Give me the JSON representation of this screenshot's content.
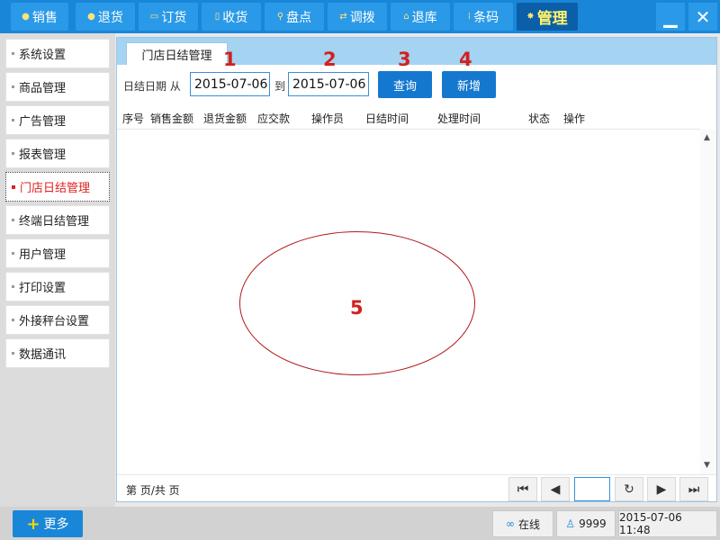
{
  "nav": {
    "items": [
      {
        "label": "销售",
        "icon": "dot-icon"
      },
      {
        "label": "退货",
        "icon": "dot-icon"
      },
      {
        "label": "订货",
        "icon": "chat-icon"
      },
      {
        "label": "收货",
        "icon": "document-icon"
      },
      {
        "label": "盘点",
        "icon": "magnifier-icon"
      },
      {
        "label": "调拨",
        "icon": "swap-arrows-icon"
      },
      {
        "label": "退库",
        "icon": "home-icon"
      },
      {
        "label": "条码",
        "icon": "barcode-icon"
      },
      {
        "label": "管理",
        "icon": "gear-icon"
      }
    ],
    "active": "管理",
    "minimize": "minimize-icon",
    "close": "close-icon"
  },
  "sidebar": {
    "items": [
      {
        "label": "系统设置"
      },
      {
        "label": "商品管理"
      },
      {
        "label": "广告管理"
      },
      {
        "label": "报表管理"
      },
      {
        "label": "门店日结管理"
      },
      {
        "label": "终端日结管理"
      },
      {
        "label": "用户管理"
      },
      {
        "label": "打印设置"
      },
      {
        "label": "外接秤台设置"
      },
      {
        "label": "数据通讯"
      }
    ],
    "active": "门店日结管理"
  },
  "tab": {
    "label": "门店日结管理"
  },
  "filter": {
    "date_label": "日结日期 从",
    "to_label": "到",
    "from_value": "2015-07-06",
    "to_value": "2015-07-06",
    "query_label": "查询",
    "add_label": "新增"
  },
  "annotations": {
    "a1": "1",
    "a2": "2",
    "a3": "3",
    "a4": "4",
    "a5": "5"
  },
  "table": {
    "columns": [
      "序号",
      "销售金额",
      "退货金额",
      "应交款",
      "操作员",
      "日结时间",
      "处理时间",
      "状态",
      "操作"
    ],
    "rows": []
  },
  "pagination": {
    "info": "第 页/共 页",
    "page_value": ""
  },
  "bottombar": {
    "more_label": "更多",
    "status_online": "在线",
    "user_id": "9999",
    "datetime": "2015-07-06 11:48"
  },
  "colors": {
    "primary": "#1a86d8",
    "active_nav": "#0b5fa8",
    "accent_text": "#fff36a",
    "active_side": "#e02020",
    "annotation": "#d32020"
  }
}
